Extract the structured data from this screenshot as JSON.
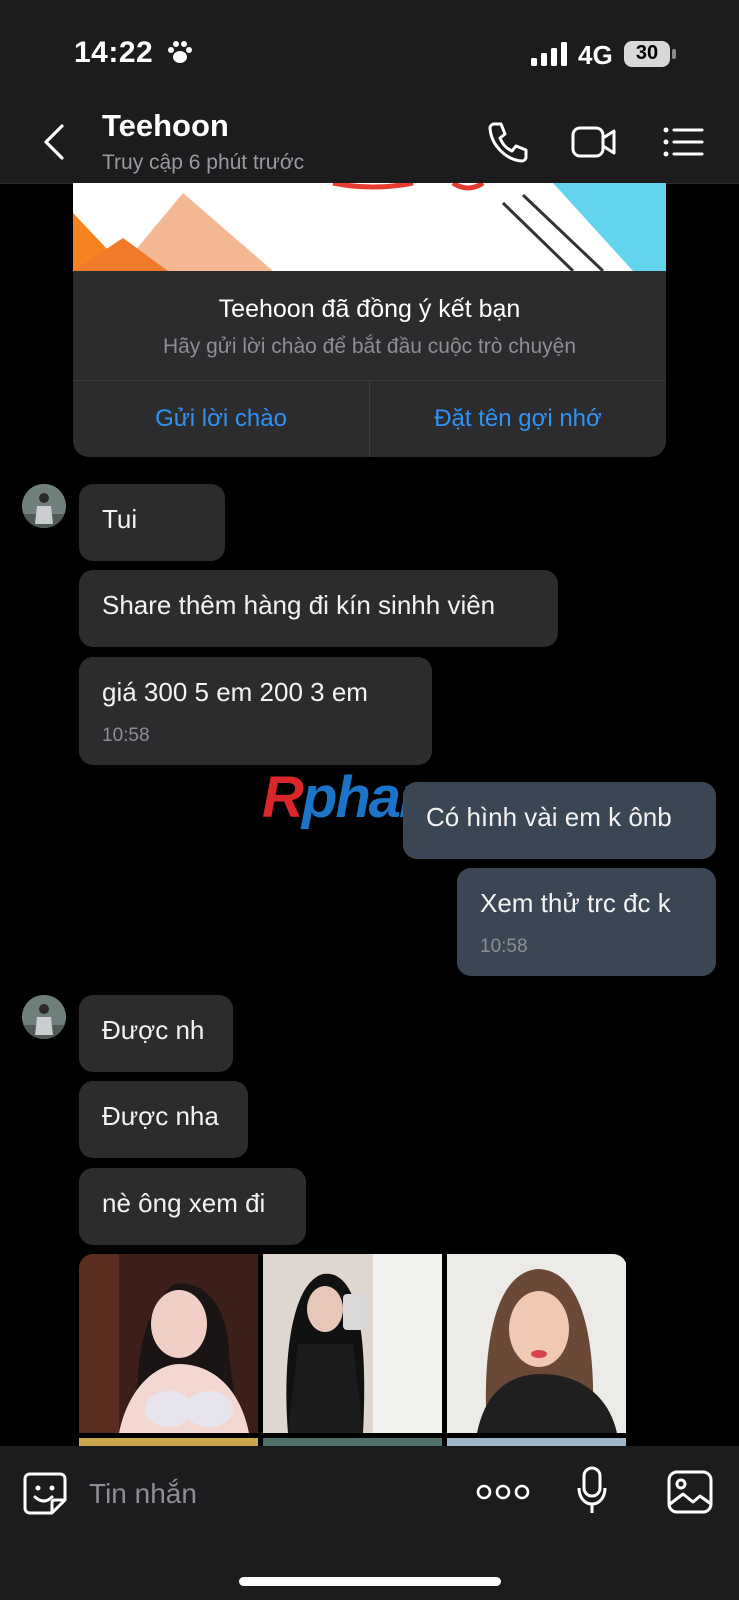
{
  "status_bar": {
    "time": "14:22",
    "network": "4G",
    "battery": "30"
  },
  "header": {
    "name": "Teehoon",
    "last_seen": "Truy cập 6 phút trước"
  },
  "friend_card": {
    "title": "Teehoon đã đồng ý kết bạn",
    "subtitle": "Hãy gửi lời chào để bắt đầu cuộc trò chuyện",
    "button_left": "Gửi lời chào",
    "button_right": "Đặt tên gợi nhớ"
  },
  "messages": [
    {
      "from": "them",
      "text": "Tui"
    },
    {
      "from": "them",
      "text": "Share thêm hàng đi kín sinhh viên"
    },
    {
      "from": "them",
      "text": "giá 300 5 em  200 3 em",
      "time": "10:58"
    },
    {
      "from": "me",
      "text": "Có hình vài em k ônb"
    },
    {
      "from": "me",
      "text": "Xem thử trc đc k",
      "time": "10:58"
    },
    {
      "from": "them",
      "text": "Được nh"
    },
    {
      "from": "them",
      "text": "Được nha"
    },
    {
      "from": "them",
      "text": "nè ông xem đi"
    }
  ],
  "watermark": {
    "part1": "R",
    "part2": "phang"
  },
  "input": {
    "placeholder": "Tin nhắn"
  },
  "colors": {
    "accent": "#2f93f5",
    "bubble_them": "#2c2c2e",
    "bubble_me": "#3a4654"
  }
}
